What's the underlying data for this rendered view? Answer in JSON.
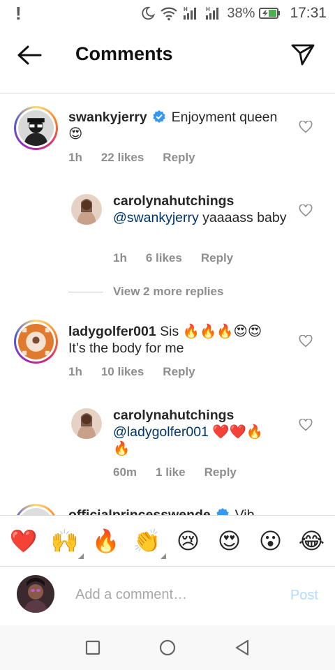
{
  "status_bar": {
    "alert": "!",
    "battery_percent": "38%",
    "time": "17:31"
  },
  "header": {
    "title": "Comments"
  },
  "comments": [
    {
      "username": "swankyjerry",
      "verified": true,
      "text": "Enjoyment queen",
      "emoji_line": "😍",
      "time": "1h",
      "likes": "22 likes",
      "reply": "Reply"
    },
    {
      "username": "carolynahutchings",
      "mention": "@swankyjerry",
      "text": "yaaaass baby",
      "time": "1h",
      "likes": "6 likes",
      "reply": "Reply"
    },
    {
      "username": "ladygolfer001",
      "text": "Sis 🔥🔥🔥😍😍",
      "text_line2": "It’s the body for me",
      "time": "1h",
      "likes": "10 likes",
      "reply": "Reply"
    },
    {
      "username": "carolynahutchings",
      "mention": "@ladygolfer001",
      "text": "❤️❤️🔥",
      "emoji_line": "🔥",
      "time": "60m",
      "likes": "1 like",
      "reply": "Reply"
    },
    {
      "username": "officialprincesswende",
      "text": "Vib..."
    }
  ],
  "view_more": "View 2 more replies",
  "emoji_bar": [
    "❤️",
    "🙌",
    "🔥",
    "👏",
    "😢",
    "😍",
    "😮",
    "😂"
  ],
  "composer": {
    "placeholder": "Add a comment…",
    "post_label": "Post"
  },
  "colors": {
    "text": "#262626",
    "muted": "#8e8e8e",
    "mention": "#003569",
    "verified": "#3897f0",
    "post_disabled": "#b3dbff"
  }
}
